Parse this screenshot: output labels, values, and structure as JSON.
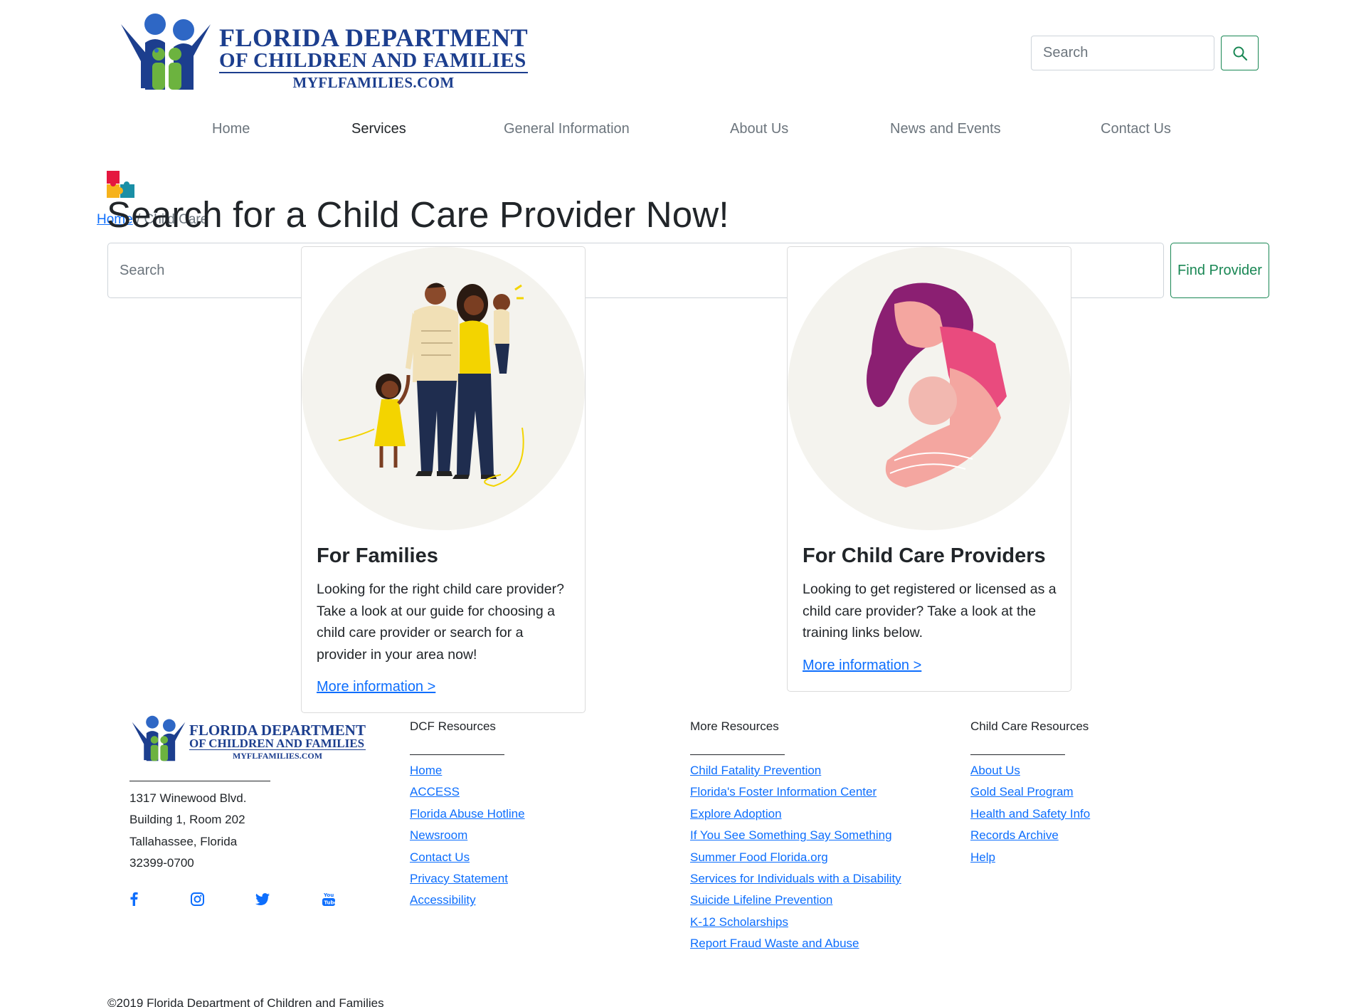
{
  "header": {
    "logo": {
      "line1": "FLORIDA DEPARTMENT",
      "line2": "OF CHILDREN AND FAMILIES",
      "line3": "MYFLFAMILIES.COM"
    },
    "search_placeholder": "Search",
    "search_button_icon": "search-icon"
  },
  "nav": {
    "items": [
      {
        "label": "Home",
        "active": false
      },
      {
        "label": "Services",
        "active": true
      },
      {
        "label": "General Information",
        "active": false
      },
      {
        "label": "About Us",
        "active": false
      },
      {
        "label": "News and Events",
        "active": false
      },
      {
        "label": "Contact Us",
        "active": false
      }
    ]
  },
  "hero": {
    "breadcrumb_home": "Home",
    "breadcrumb_separator": "/",
    "breadcrumb_current": "Child Care",
    "title": "Search for a Child Care Provider Now!",
    "search_placeholder": "Search",
    "find_button": "Find Provider"
  },
  "cards": [
    {
      "title": "For Families",
      "text": "Looking for the right child care provider? Take a look at our guide for choosing a child care provider or search for a provider in your area now!",
      "link": "More information >"
    },
    {
      "title": "For Child Care Providers",
      "text": "Looking to get registered or licensed as a child care provider? Take a look at the training links below.",
      "link": "More information >"
    }
  ],
  "footer": {
    "logo": {
      "line1": "FLORIDA DEPARTMENT",
      "line2": "OF CHILDREN AND FAMILIES",
      "line3": "MYFLFAMILIES.COM"
    },
    "address": [
      "1317 Winewood Blvd.",
      "Building 1, Room 202",
      "Tallahassee, Florida",
      "32399-0700"
    ],
    "social_icons": [
      "facebook-icon",
      "instagram-icon",
      "twitter-icon",
      "youtube-icon"
    ],
    "columns": [
      {
        "heading": "DCF Resources",
        "links": [
          "Home",
          "ACCESS",
          "Florida Abuse Hotline",
          "Newsroom",
          "Contact Us",
          "Privacy Statement",
          "Accessibility"
        ]
      },
      {
        "heading": "More Resources",
        "links": [
          "Child Fatality Prevention",
          "Florida's Foster Information Center",
          "Explore Adoption",
          "If You See Something Say Something",
          "Summer Food Florida.org",
          "Services for Individuals with a Disability",
          "Suicide Lifeline Prevention",
          "K-12 Scholarships",
          "Report Fraud Waste and Abuse"
        ]
      },
      {
        "heading": "Child Care Resources",
        "links": [
          "About Us",
          "Gold Seal Program",
          "Health and Safety Info",
          "Records Archive",
          "Help"
        ]
      }
    ],
    "copyright": "©2019 Florida Department of Children and Families"
  },
  "colors": {
    "brand_blue": "#1c3e8e",
    "link_blue": "#0d6efd",
    "accent_green": "#198754",
    "logo_green": "#6cb33f"
  }
}
